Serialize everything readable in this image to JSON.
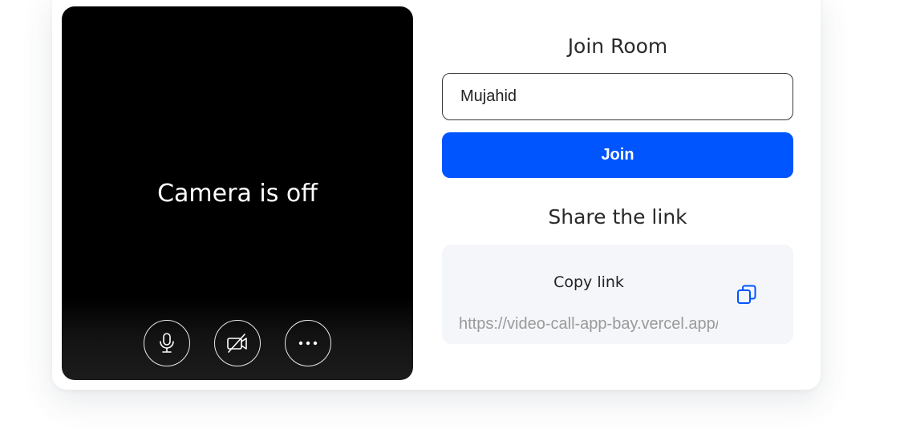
{
  "preview": {
    "camera_status": "Camera is off",
    "controls": [
      {
        "name": "microphone",
        "icon": "microphone-icon"
      },
      {
        "name": "camera",
        "icon": "video-off-icon"
      },
      {
        "name": "more",
        "icon": "more-horizontal-icon"
      }
    ]
  },
  "join": {
    "heading": "Join Room",
    "name_value": "Mujahid",
    "button_label": "Join",
    "button_color": "#0055ff"
  },
  "share": {
    "heading": "Share the link",
    "copy_label": "Copy link",
    "copy_icon": "copy-icon",
    "link": "https://video-call-app-bay.vercel.app/room",
    "accent_color": "#0055ff"
  }
}
